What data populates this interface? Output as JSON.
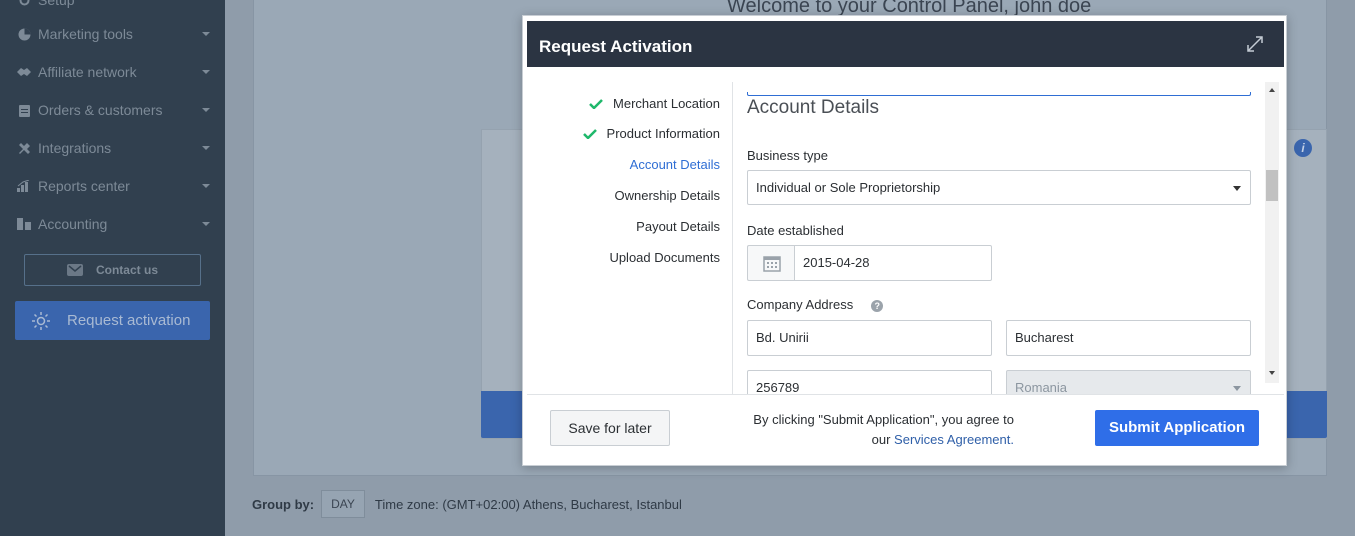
{
  "sidebar": {
    "items": [
      {
        "label": "Setup",
        "icon": "setup-icon"
      },
      {
        "label": "Marketing tools",
        "icon": "pie-chart-icon"
      },
      {
        "label": "Affiliate network",
        "icon": "handshake-icon"
      },
      {
        "label": "Orders & customers",
        "icon": "clipboard-icon"
      },
      {
        "label": "Integrations",
        "icon": "plug-icon"
      },
      {
        "label": "Reports center",
        "icon": "bar-chart-icon"
      },
      {
        "label": "Accounting",
        "icon": "ledger-icon"
      }
    ],
    "contact_label": "Contact us",
    "request_label": "Request activation"
  },
  "dashboard": {
    "welcome": "Welcome to your Control Panel, john doe",
    "info_glyph": "i",
    "group_by_label": "Group by:",
    "day_label": "DAY",
    "timezone": "Time zone: (GMT+02:00) Athens, Bucharest, Istanbul"
  },
  "modal": {
    "title": "Request Activation",
    "steps": [
      {
        "label": "Merchant Location",
        "status": "done"
      },
      {
        "label": "Product Information",
        "status": "done"
      },
      {
        "label": "Account Details",
        "status": "active"
      },
      {
        "label": "Ownership Details",
        "status": "pending"
      },
      {
        "label": "Payout Details",
        "status": "pending"
      },
      {
        "label": "Upload Documents",
        "status": "pending"
      }
    ],
    "section_title": "Account Details",
    "business_type_label": "Business type",
    "business_type_value": "Individual or Sole Proprietorship",
    "date_label": "Date established",
    "date_value": "2015-04-28",
    "address_label": "Company Address",
    "address": {
      "street": "Bd. Unirii",
      "city": "Bucharest",
      "postal_code": "256789",
      "country": "Romania"
    },
    "footer": {
      "save_label": "Save for later",
      "agree_text": "By clicking \"Submit Application\", you agree to",
      "agree_prefix": "our",
      "agree_link": "Services Agreement.",
      "submit_label": "Submit Application"
    }
  },
  "colors": {
    "sidebar_bg": "#31404f",
    "header_bg": "#2b3442",
    "accent": "#2f6ee8",
    "check": "#1fb86b",
    "active_step": "#2f6ed4"
  }
}
